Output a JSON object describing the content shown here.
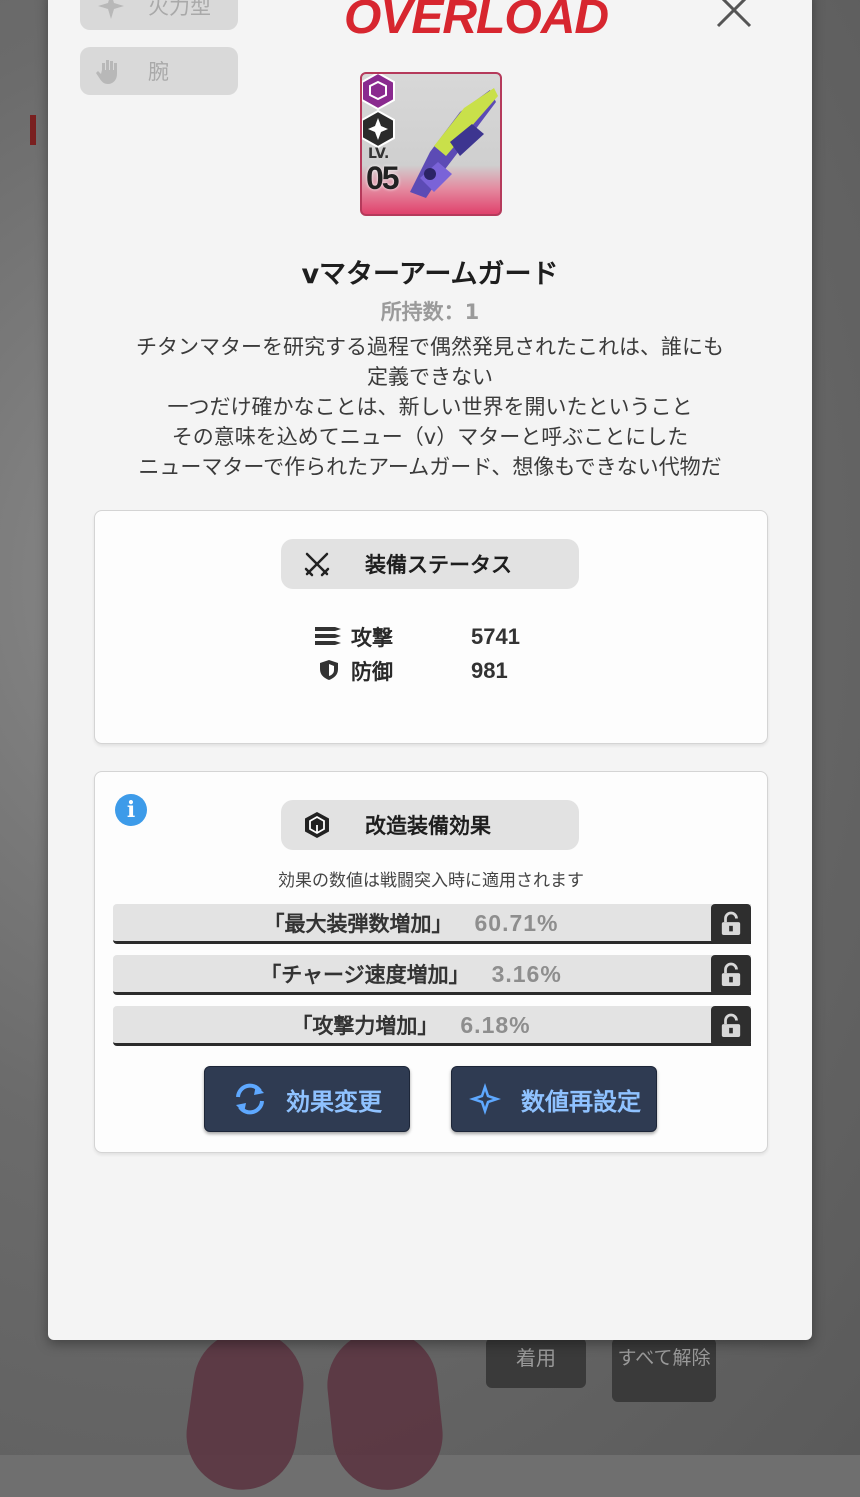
{
  "chips": [
    {
      "label": "火力型",
      "icon": "burst-icon"
    },
    {
      "label": "腕",
      "icon": "glove-icon"
    }
  ],
  "logo": "OVERLOAD",
  "item": {
    "level_label": "LV.",
    "level": "05",
    "name": "vマターアームガード",
    "owned": "所持数：1",
    "description": [
      "チタンマターを研究する過程で偶然発見されたこれは、誰にも",
      "定義できない",
      "一つだけ確かなことは、新しい世界を開いたということ",
      "その意味を込めてニュー（v）マターと呼ぶことにした",
      "ニューマターで作られたアームガード、想像もできない代物だ"
    ]
  },
  "status": {
    "title": "装備ステータス",
    "stats": [
      {
        "label": "攻撃",
        "value": "5741",
        "icon": "bullets-icon"
      },
      {
        "label": "防御",
        "value": "981",
        "icon": "shield-icon"
      }
    ]
  },
  "overload": {
    "title": "改造装備効果",
    "note": "効果の数値は戦闘突入時に適用されます",
    "effects": [
      {
        "name": "「最大装弾数増加」",
        "value": "60.71%"
      },
      {
        "name": "「チャージ速度増加」",
        "value": "3.16%"
      },
      {
        "name": "「攻撃力増加」",
        "value": "6.18%"
      }
    ],
    "buttons": {
      "change": "効果変更",
      "reset": "数値再設定"
    }
  },
  "background_buttons": {
    "equip": "着用",
    "unequip": "すべて解除"
  },
  "colors": {
    "accent_red": "#d7262f",
    "button_bg": "#2f3b52",
    "button_text": "#8fc2ff",
    "info_blue": "#3d9be9",
    "card_pink": "#e0426c"
  }
}
